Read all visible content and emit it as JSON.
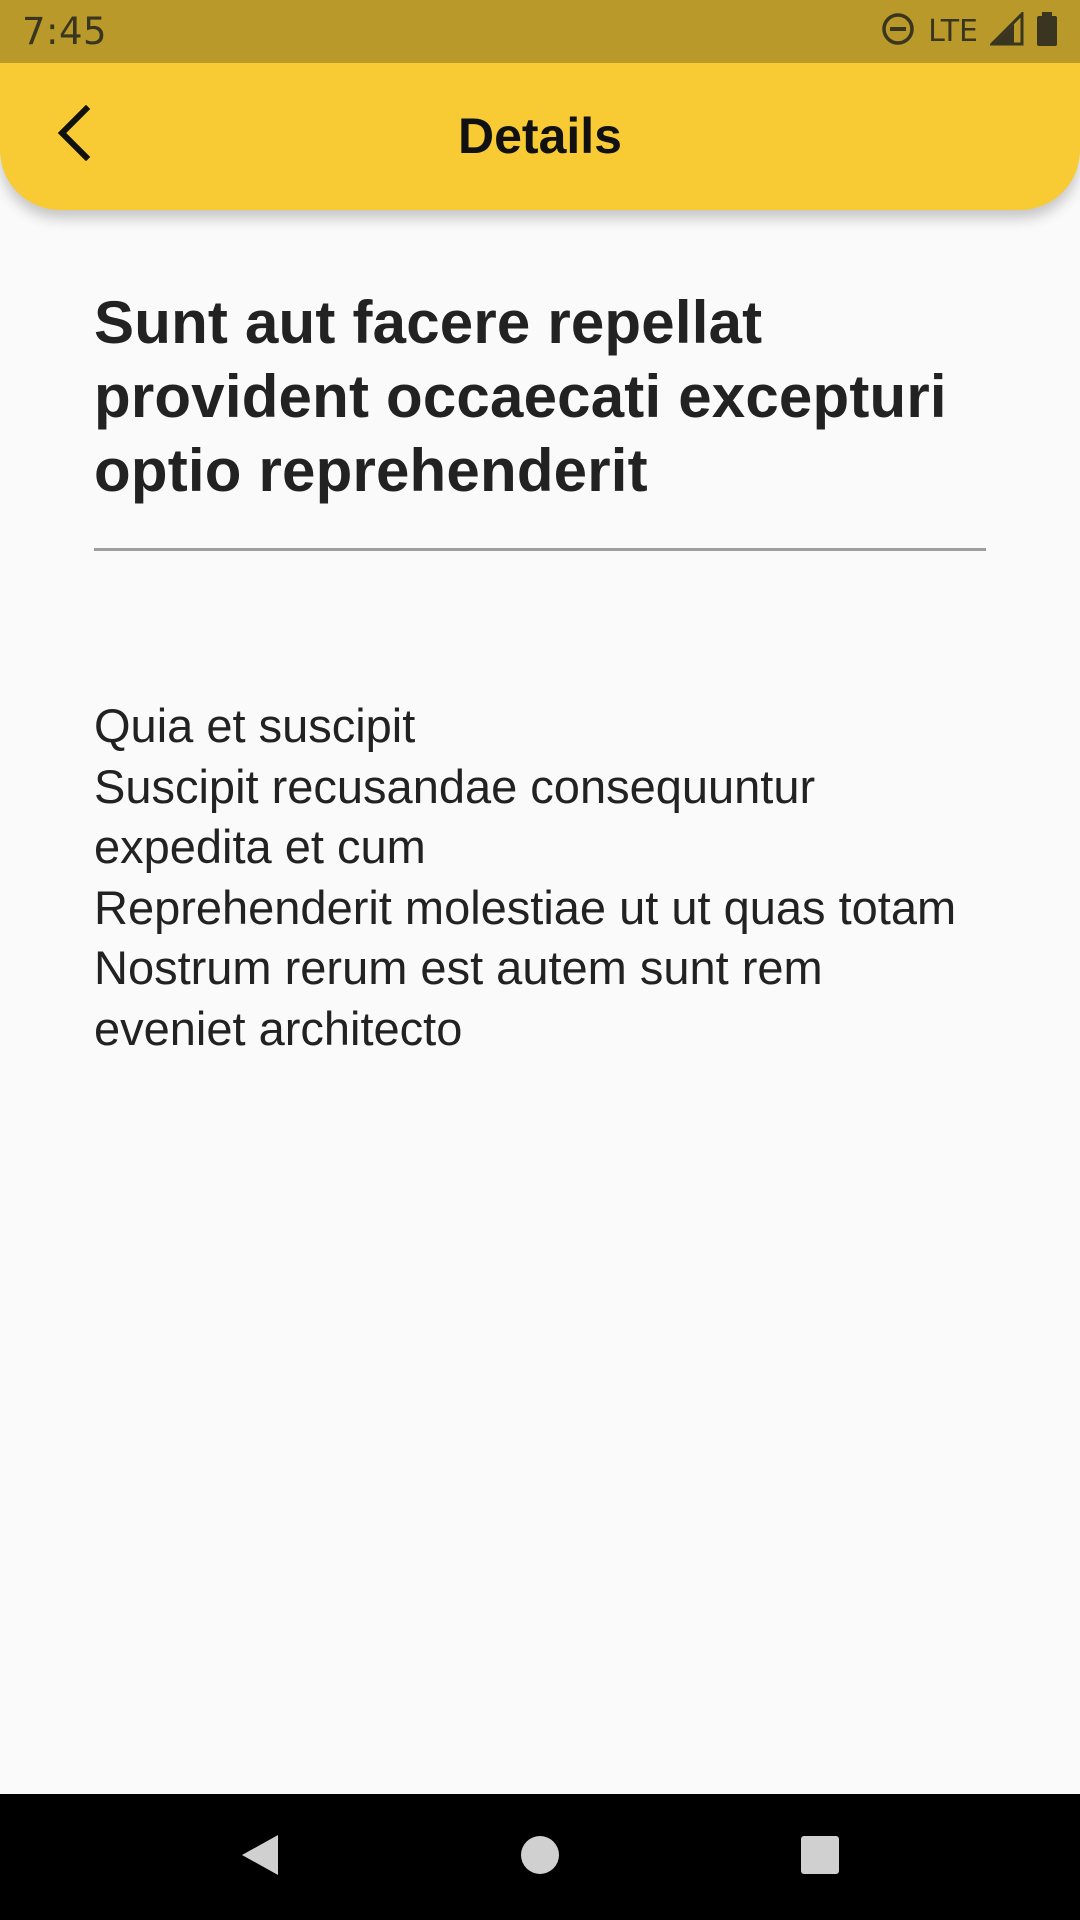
{
  "status_bar": {
    "time": "7:45",
    "network": "LTE",
    "icons": [
      "do-not-disturb-icon",
      "signal-icon",
      "battery-icon"
    ]
  },
  "app_bar": {
    "title": "Details",
    "back_icon": "chevron-left-icon",
    "color": "#f8cb35"
  },
  "post": {
    "title": "Sunt aut facere repellat provident occaecati excepturi optio reprehenderit",
    "body": "Quia et suscipit\nSuscipit recusandae consequuntur expedita et cum\nReprehenderit molestiae ut ut quas totam\nNostrum rerum est autem sunt rem eveniet architecto"
  },
  "nav_bar": {
    "buttons": [
      "back-triangle-icon",
      "home-circle-icon",
      "recents-square-icon"
    ]
  },
  "colors": {
    "status_bar": "#b8992a",
    "accent": "#f8cb35",
    "background": "#fafafa",
    "text": "#222222"
  }
}
